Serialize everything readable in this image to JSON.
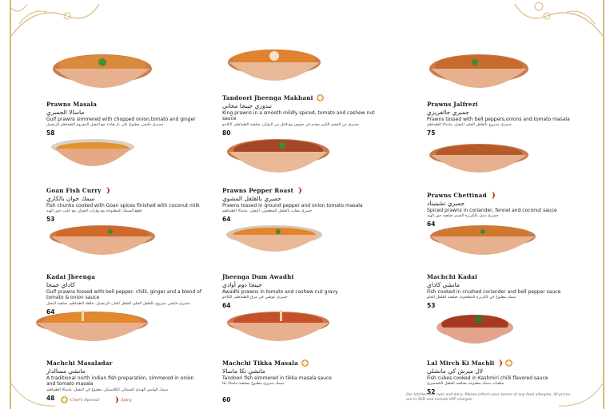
{
  "colors": {
    "border": "#d9b77a",
    "badge": "#d9a441",
    "spicy": "#c8321e"
  },
  "dishes": [
    {
      "name": "Prawns Masala",
      "arabic": "ماسالا الجمبري",
      "desc": "Gulf prawns simmered with chopped onion,tomato and ginger",
      "arabic_desc": "جمبري خليجي مطبوخ على نار هادئة مع البصل المفروم الطماطم الزنجبيل",
      "price": "58",
      "chef": false,
      "spicy": false
    },
    {
      "name": "Tandoori Jheenga Makhani",
      "arabic": "تندوري جينجا مخاني",
      "desc": "King prawns in a smooth mildly spiced, tomato and cashew nut sauce",
      "arabic_desc": "جمبري من الحجم الكبير مقدم في صوص مع قليل من التوابل، صلصة الطماطم، الكاجو",
      "price": "80",
      "chef": true,
      "spicy": false
    },
    {
      "name": "Prawns Jalfrezi",
      "arabic": "جمبري جالفريزي",
      "desc": "Prawns tossed with bell peppers,onions and tomato masala",
      "arabic_desc": "جمبري ممزوج بالفلفل الحلو، البصل، ماسالا الطماطم",
      "price": "75",
      "chef": false,
      "spicy": false
    },
    {
      "name": "Goan Fish Curry",
      "arabic": "سمك جوان بالكاري",
      "desc": "Fish chunks cooked with Goan spices finished with coconut milk",
      "arabic_desc": "قطع السمك المطبوخة مع بهارات الجوان مع حليب جوز الهند",
      "price": "53",
      "chef": false,
      "spicy": true
    },
    {
      "name": "Prawns Pepper Roast",
      "arabic": "جمبري بالفلفل المشوي",
      "desc": "Prawns tossed in ground pepper and onion tomato masala",
      "arabic_desc": "جمبري مقلب بالفلفل المطحون، البصل، ماسالا الطماطم",
      "price": "64",
      "chef": false,
      "spicy": true
    },
    {
      "name": "Prawns Chettinad",
      "arabic": "جمبري تشيتيناد",
      "desc": "Spiced prawns in coriander, fennel and coconut sauce",
      "arabic_desc": "جمبري متبل بالكزبرة الشمر صلصة جوز الهند",
      "price": "64",
      "chef": false,
      "spicy": true
    },
    {
      "name": "Kadai Jheenga",
      "arabic": "كاداي جينجا",
      "desc": "Gulf prawns tossed with bell pepper, chilli, ginger and a blend of tomato & onion sauce",
      "arabic_desc": "جمبري خليجي ممزوج بالفلفل الحلو، الفلفل الحار، الزنجبيل، خلطة الطماطم، صلصة البصل",
      "price": "64",
      "chef": false,
      "spicy": false
    },
    {
      "name": "Jheenga Dum Awadhi",
      "arabic": "جينجا دوم أوادي",
      "desc": "Awadhi prawns in tomato and cashew nut gravy",
      "arabic_desc": "جمبري عوضي في مرق الطماطم، الكاجو",
      "price": "64",
      "chef": false,
      "spicy": false
    },
    {
      "name": "Machchi Kadai",
      "arabic": "مانشي كاداي",
      "desc": "Fish cooked in crushed coriander and bell pepper sauce",
      "arabic_desc": "سمك مطبوخ في الكزبرة المطحونة، صلصة الفلفل الحلو",
      "price": "53",
      "chef": false,
      "spicy": false
    },
    {
      "name": "Machchi Masaladar",
      "arabic": "مانشي مسالدار",
      "desc": "A traditional north indian fish preparation, simmered in onion and tomato masala",
      "arabic_desc": "سمك الهامور الهندي الشمالي الكلاسيكي مطبوخ في البصل، ماسالا الطماطم",
      "price": "48",
      "chef": false,
      "spicy": false
    },
    {
      "name": "Machchi Tikka Masala",
      "arabic": "مانشي تكا ماسالا",
      "desc": "Tandoori fish simmered in tikka masala sauce",
      "arabic_desc": "سمك تندوري مطبوخ بصلصة ماسالا تكا",
      "price": "60",
      "chef": true,
      "spicy": false
    },
    {
      "name": "Lal Mirch Ki Machli",
      "arabic": "لال ميرش كي مانشلي",
      "desc": "Fish cubes cooked in Kashmiri chilli flavored sauce",
      "arabic_desc": "مكعبات سمك مطبوخة بصلصة الفلفل الكشميري",
      "price": "52",
      "chef": true,
      "spicy": true
    }
  ],
  "legend": {
    "chef_label": "Chef's Special",
    "spicy_label": "Spicy"
  },
  "footnote": "Our kitchen use nuts and dairy. Please inform your server of any food allergies. All prices are in AED and include VAT charges."
}
